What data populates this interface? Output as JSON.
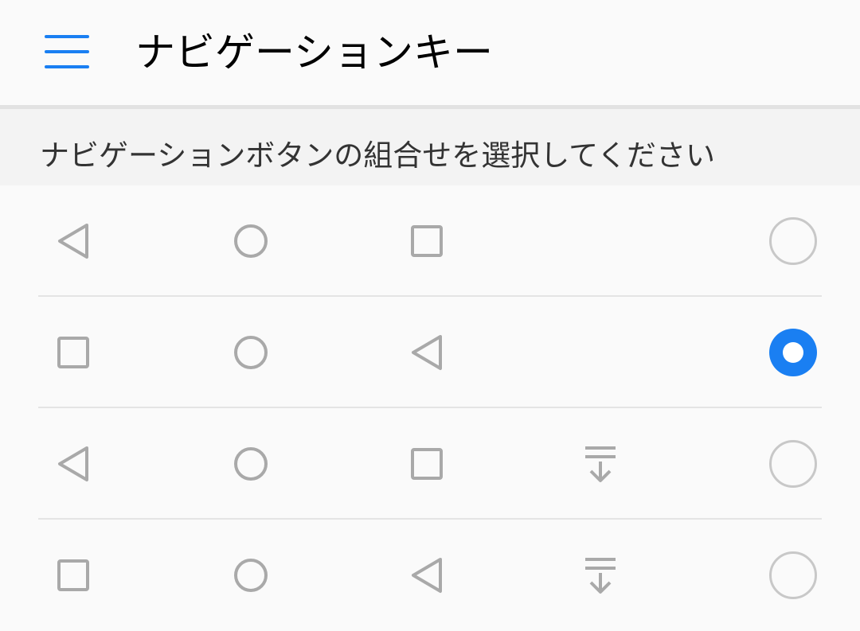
{
  "header": {
    "title": "ナビゲーションキー",
    "menu_icon": "hamburger-menu-icon"
  },
  "subheader": {
    "text": "ナビゲーションボタンの組合せを選択してください"
  },
  "colors": {
    "accent": "#1a7ff2",
    "icon_gray": "#a9a9a9",
    "radio_border": "#c8c8c8",
    "divider": "#e4e4e4"
  },
  "options": [
    {
      "icons": [
        "back-icon",
        "home-icon",
        "recent-apps-icon"
      ],
      "selected": false
    },
    {
      "icons": [
        "recent-apps-icon",
        "home-icon",
        "back-icon"
      ],
      "selected": true
    },
    {
      "icons": [
        "back-icon",
        "home-icon",
        "recent-apps-icon",
        "notification-pull-down-icon"
      ],
      "selected": false
    },
    {
      "icons": [
        "recent-apps-icon",
        "home-icon",
        "back-icon",
        "notification-pull-down-icon"
      ],
      "selected": false
    }
  ]
}
